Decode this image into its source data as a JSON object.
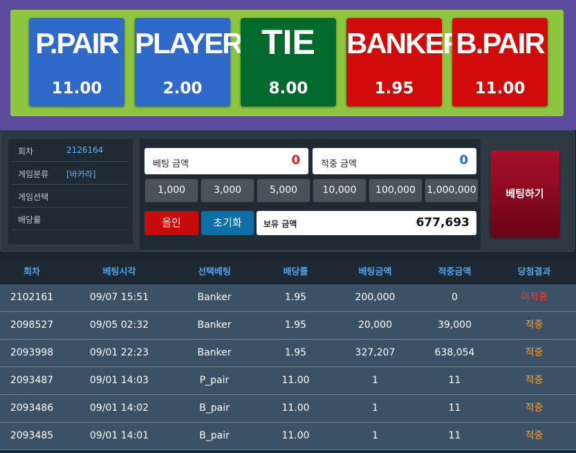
{
  "bet_board": [
    {
      "label": "P.PAIR",
      "odds": "11.00",
      "color": "#2f69c9"
    },
    {
      "label": "PLAYER",
      "odds": "2.00",
      "color": "#2f69c9"
    },
    {
      "label": "TIE",
      "odds": "8.00",
      "color": "#036a2e"
    },
    {
      "label": "BANKER",
      "odds": "1.95",
      "color": "#d10b0b"
    },
    {
      "label": "B.PAIR",
      "odds": "11.00",
      "color": "#d10b0b"
    }
  ],
  "info": {
    "round_label": "회차",
    "round_value": "2126164",
    "category_label": "게임분류",
    "category_value": "[바카라]",
    "selection_label": "게임선택",
    "selection_value": "",
    "odds_label": "배당률",
    "odds_value": ""
  },
  "bet_panel": {
    "bet_amount_label": "베팅 금액",
    "bet_amount_value": "0",
    "win_amount_label": "적중 금액",
    "win_amount_value": "0",
    "chips": [
      "1,000",
      "3,000",
      "5,000",
      "10,000",
      "100,000",
      "1,000,000"
    ],
    "allin_label": "올인",
    "reset_label": "초기화",
    "balance_label": "보유 금액",
    "balance_value": "677,693",
    "place_bet_label": "베팅하기"
  },
  "history": {
    "columns": [
      "회차",
      "베팅시각",
      "선택베팅",
      "배당률",
      "베팅금액",
      "적중금액",
      "당첨결과"
    ],
    "rows": [
      [
        "2102161",
        "09/07 15:51",
        "Banker",
        "1.95",
        "200,000",
        "0",
        "미적중"
      ],
      [
        "2098527",
        "09/05 02:32",
        "Banker",
        "1.95",
        "20,000",
        "39,000",
        "적중"
      ],
      [
        "2093998",
        "09/01 22:23",
        "Banker",
        "1.95",
        "327,207",
        "638,054",
        "적중"
      ],
      [
        "2093487",
        "09/01 14:03",
        "P_pair",
        "11.00",
        "1",
        "11",
        "적중"
      ],
      [
        "2093486",
        "09/01 14:02",
        "B_pair",
        "11.00",
        "1",
        "11",
        "적중"
      ],
      [
        "2093485",
        "09/01 14:01",
        "B_pair",
        "11.00",
        "1",
        "11",
        "적중"
      ]
    ]
  },
  "colors": {
    "accent_blue": "#4ea4ee",
    "bet_zero_red": "#e0201a",
    "win_zero_blue": "#1a6fd8",
    "result_miss": "#ff3b2f",
    "result_hit": "#ff9f2f"
  }
}
